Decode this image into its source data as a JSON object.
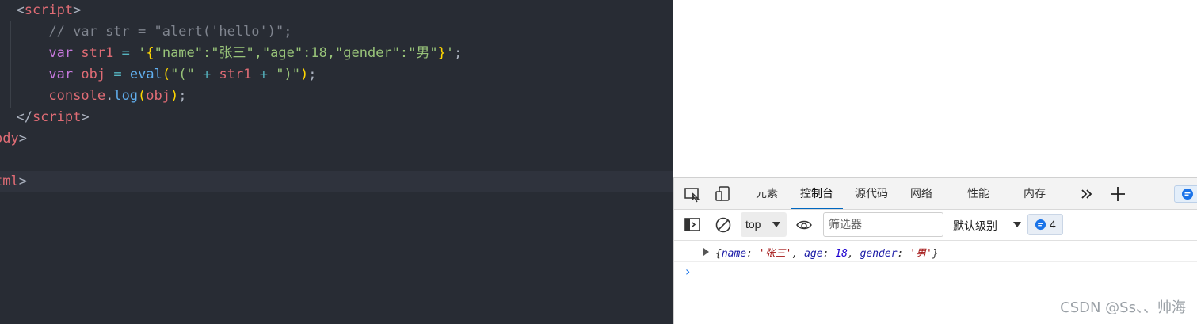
{
  "editor": {
    "l0_open": "<",
    "l0_tag": "script",
    "l0_close": ">",
    "l1_comment": "// var str = \"alert('hello')\";",
    "l2_kw": "var",
    "l2_name": "str1",
    "l2_eq": "=",
    "l2_q1": "'",
    "l2_b1": "{",
    "l2_body": "\"name\":\"张三\",\"age\":18,\"gender\":\"男\"",
    "l2_b2": "}",
    "l2_q2": "'",
    "l2_semi": ";",
    "l3_kw": "var",
    "l3_name": "obj",
    "l3_eq": "=",
    "l3_fn": "eval",
    "l3_p1": "(",
    "l3_s1": "\"(\"",
    "l3_plus1": "+",
    "l3_arg": "str1",
    "l3_plus2": "+",
    "l3_s2": "\")\"",
    "l3_p2": ")",
    "l3_semi": ";",
    "l4_obj": "console",
    "l4_dot": ".",
    "l4_fn": "log",
    "l4_p1": "(",
    "l4_arg": "obj",
    "l4_p2": ")",
    "l4_semi": ";",
    "l5_open": "</",
    "l5_tag": "script",
    "l5_close": ">",
    "l6_tag": "ody",
    "l6_close": ">",
    "l8_tag": "tml",
    "l8_close": ">"
  },
  "devtools": {
    "icons": [
      "inspect-element-icon",
      "device-toolbar-icon",
      "more-tabs-icon",
      "add-tab-icon",
      "sidebar-toggle-icon",
      "clear-console-icon",
      "eye-icon",
      "message-icon"
    ],
    "tabs": [
      "元素",
      "控制台",
      "源代码",
      "网络",
      "性能",
      "内存"
    ],
    "active_tab": "控制台",
    "context": "top",
    "filter_placeholder": "筛选器",
    "levels": "默认级别",
    "message_count": "4",
    "log": {
      "open": "{",
      "k1": "name",
      "v1": "'张三'",
      "k2": "age",
      "v2": "18",
      "k3": "gender",
      "v3": "'男'",
      "close": "}",
      "sep": ": ",
      "comma": ", "
    },
    "prompt": "›"
  },
  "watermark": "CSDN @Ss、、帅海",
  "colors": {
    "accent": "#0067c0",
    "editor_bg": "#282c34"
  }
}
